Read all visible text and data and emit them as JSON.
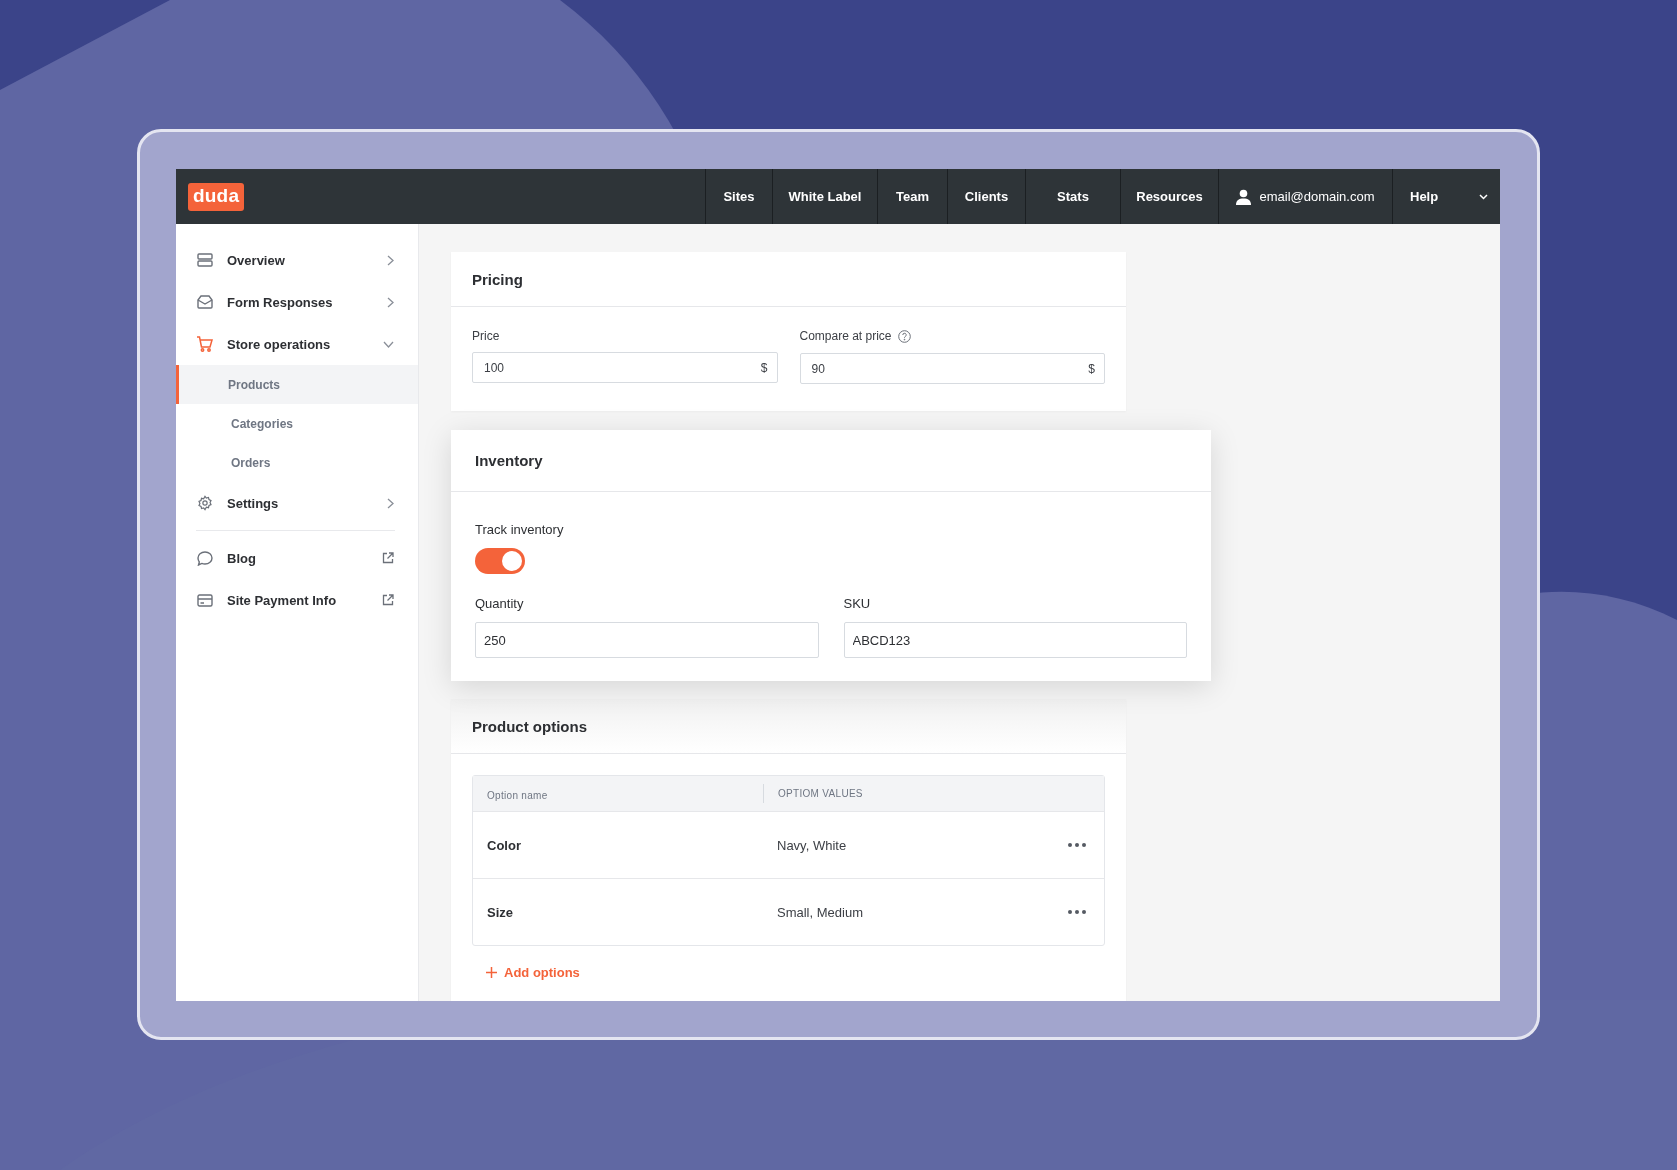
{
  "logo": "duda",
  "nav": [
    {
      "label": "Sites"
    },
    {
      "label": "White Label"
    },
    {
      "label": "Team"
    },
    {
      "label": "Clients"
    },
    {
      "label": "Stats"
    },
    {
      "label": "Resources"
    },
    {
      "label": "email@domain.com",
      "kind": "account"
    },
    {
      "label": "Help",
      "kind": "menu"
    }
  ],
  "sidebar": {
    "items": [
      {
        "label": "Overview",
        "kind": "link"
      },
      {
        "label": "Form Responses",
        "kind": "link"
      },
      {
        "label": "Store operations",
        "kind": "group",
        "expanded": true,
        "children": [
          {
            "label": "Products",
            "selected": true
          },
          {
            "label": "Categories",
            "selected": false
          },
          {
            "label": "Orders",
            "selected": false
          }
        ]
      },
      {
        "label": "Settings",
        "kind": "link"
      },
      {
        "kind": "divider"
      },
      {
        "label": "Blog",
        "kind": "external"
      },
      {
        "label": "Site Payment Info",
        "kind": "external"
      }
    ]
  },
  "pricing": {
    "title": "Pricing",
    "fields": [
      {
        "label": "Price",
        "value": "100",
        "suffix": "$",
        "help": false
      },
      {
        "label": "Compare at price",
        "value": "90",
        "suffix": "$",
        "help": true
      }
    ]
  },
  "inventory": {
    "title": "Inventory",
    "track_label": "Track inventory",
    "track_on": true,
    "fields": [
      {
        "label": "Quantity",
        "value": "250"
      },
      {
        "label": "SKU",
        "value": "ABCD123"
      }
    ]
  },
  "product_options": {
    "title": "Product options",
    "columns": [
      "Option name",
      "OPTIOM VALUES"
    ],
    "rows": [
      {
        "name": "Color",
        "values": "Navy, White"
      },
      {
        "name": "Size",
        "values": "Small, Medium"
      }
    ],
    "add_label": "Add options"
  }
}
